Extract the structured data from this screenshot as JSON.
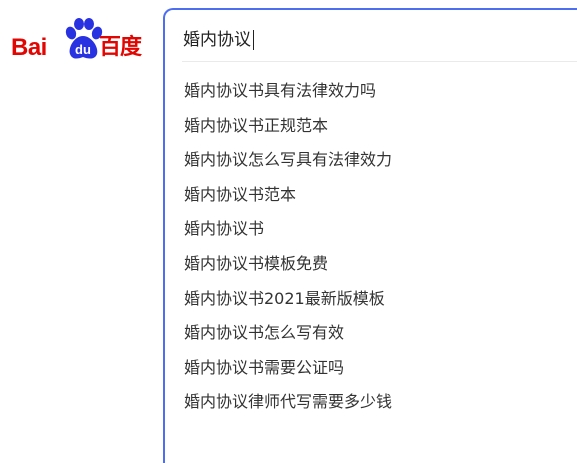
{
  "logo": {
    "latin_text": "Bai",
    "paw_text": "du",
    "cn_text": "百度"
  },
  "search": {
    "value": "婚内协议"
  },
  "suggestions": [
    "婚内协议书具有法律效力吗",
    "婚内协议书正规范本",
    "婚内协议怎么写具有法律效力",
    "婚内协议书范本",
    "婚内协议书",
    "婚内协议书模板免费",
    "婚内协议书2021最新版模板",
    "婚内协议书怎么写有效",
    "婚内协议书需要公证吗",
    "婚内协议律师代写需要多少钱"
  ],
  "colors": {
    "brand_red": "#e10602",
    "paw_blue": "#2932e1",
    "search_border": "#4e6ef2"
  }
}
